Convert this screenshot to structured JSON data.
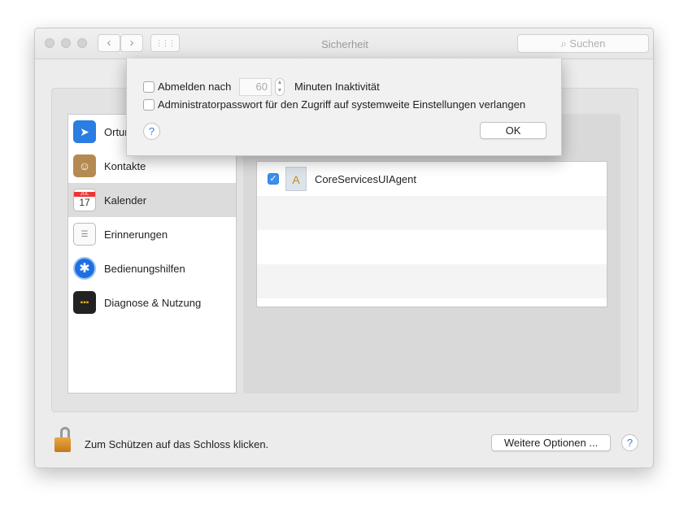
{
  "window": {
    "title": "Sicherheit",
    "search_placeholder": "Suchen",
    "back": "‹",
    "forward": "›",
    "grid": "⋮⋮⋮"
  },
  "sidebar": {
    "items": [
      {
        "label": "Ortungsdienste",
        "visible_label": "Ortun",
        "icon": "location-arrow-icon",
        "color": "#2a7de1"
      },
      {
        "label": "Kontakte",
        "icon": "contacts-book-icon",
        "color": "#b58a52"
      },
      {
        "label": "Kalender",
        "icon": "calendar-icon",
        "month": "JUL",
        "day": "17",
        "selected": true
      },
      {
        "label": "Erinnerungen",
        "icon": "reminders-icon"
      },
      {
        "label": "Bedienungshilfen",
        "icon": "accessibility-icon",
        "color": "#1f6fe0"
      },
      {
        "label": "Diagnose & Nutzung",
        "icon": "diagnostics-icon",
        "color": "#222"
      }
    ]
  },
  "apps": {
    "rows": [
      {
        "label": "CoreServicesUIAgent",
        "checked": true,
        "icon": "app-placeholder-icon"
      }
    ]
  },
  "sheet": {
    "logout_label": "Abmelden nach",
    "logout_checked": false,
    "minutes_value": "60",
    "minutes_label": "Minuten Inaktivität",
    "admin_label": "Administratorpasswort für den Zugriff auf systemweite Einstellungen verlangen",
    "admin_checked": false,
    "help": "?",
    "ok": "OK"
  },
  "footer": {
    "lock_text": "Zum Schützen auf das Schloss klicken.",
    "more_options": "Weitere Optionen ...",
    "help": "?"
  }
}
